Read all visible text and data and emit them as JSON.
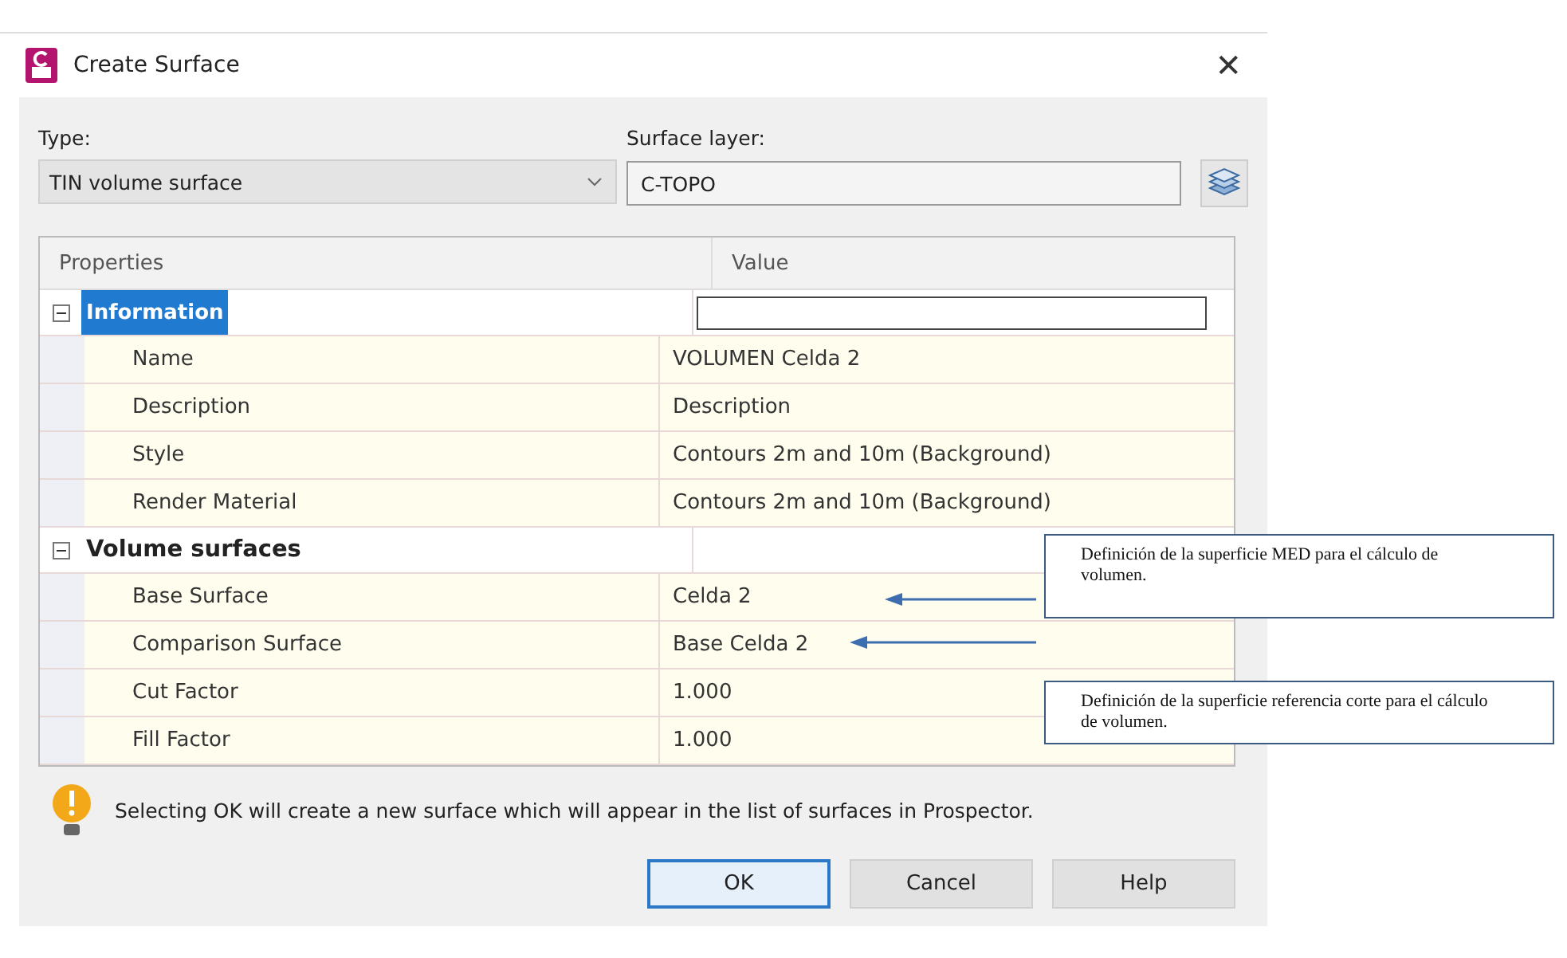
{
  "window": {
    "title": "Create Surface",
    "close_glyph": "✕"
  },
  "type_field": {
    "label": "Type:",
    "value": "TIN volume surface"
  },
  "layer_field": {
    "label": "Surface layer:",
    "value": "C-TOPO"
  },
  "grid": {
    "columns": [
      "Properties",
      "Value"
    ],
    "groups": [
      {
        "label": "Information",
        "expanded": true,
        "selected": true,
        "children": [
          {
            "name": "Name",
            "value": "VOLUMEN Celda 2"
          },
          {
            "name": "Description",
            "value": "Description"
          },
          {
            "name": "Style",
            "value": "Contours 2m and 10m (Background)"
          },
          {
            "name": "Render Material",
            "value": "Contours 2m and 10m (Background)"
          }
        ]
      },
      {
        "label": "Volume surfaces",
        "expanded": true,
        "selected": false,
        "children": [
          {
            "name": "Base Surface",
            "value": "Celda 2"
          },
          {
            "name": "Comparison Surface",
            "value": "Base Celda 2"
          },
          {
            "name": "Cut Factor",
            "value": "1.000"
          },
          {
            "name": "Fill Factor",
            "value": "1.000"
          }
        ]
      }
    ]
  },
  "info_message": "Selecting OK will create a new surface which will appear in the list of surfaces in Prospector.",
  "buttons": [
    {
      "label": "OK",
      "default": true
    },
    {
      "label": "Cancel",
      "default": false
    },
    {
      "label": "Help",
      "default": false
    }
  ],
  "annotations": [
    {
      "text": "Definición de la superficie MED para el cálculo de volumen."
    },
    {
      "text": "Definición de la superficie referencia corte para el cálculo de volumen."
    }
  ]
}
